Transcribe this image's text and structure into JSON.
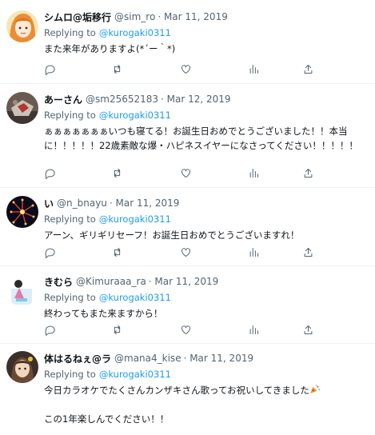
{
  "replying_to_label": "Replying to",
  "tweets": [
    {
      "name": "シムロ@垢移行",
      "handle": "@sim_ro",
      "date": "· Mar 11, 2019",
      "mention": "@kurogaki0311",
      "lines": [
        "また来年がありますよ(*´ー｀*)"
      ]
    },
    {
      "name": "あーさん",
      "handle": "@sm25652183",
      "date": "· Mar 12, 2019",
      "mention": "@kurogaki0311",
      "lines": [
        "ぁぁぁぁぁぁぁいつも寝てる！お誕生日おめでとうございました！！本当に！！！！！22歳素敵な爆・ハピネスイヤーになさってください！！！！！"
      ]
    },
    {
      "name": "い",
      "handle": "@n_bnayu",
      "date": "· Mar 11, 2019",
      "mention": "@kurogaki0311",
      "lines": [
        "アーン、ギリギリセーフ！お誕生日おめでとうございますれ！"
      ]
    },
    {
      "name": "きむら",
      "handle": "@Kimuraaa_ra",
      "date": "· Mar 11, 2019",
      "mention": "@kurogaki0311",
      "lines": [
        "終わってもまた来ますから！"
      ]
    },
    {
      "name": "体はるねぇ@ラ",
      "handle": "@mana4_kise",
      "date": "· Mar 11, 2019",
      "mention": "@kurogaki0311",
      "lines": [
        "今日カラオケでたくさんカンザキさん歌ってお祝いしてきました",
        "",
        "この1年楽しんでください！！"
      ]
    }
  ],
  "icons": [
    "reply-icon",
    "retweet-icon",
    "like-icon",
    "views-icon",
    "share-icon",
    "party-popper-icon"
  ],
  "colors": {
    "link": "#1d9bf0",
    "muted": "#536471",
    "text": "#0f1419",
    "divider": "#eff3f4"
  }
}
